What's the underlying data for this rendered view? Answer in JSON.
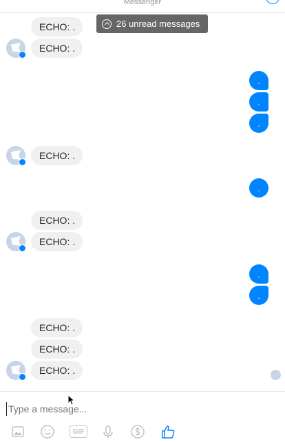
{
  "header": {
    "title": "Messenger"
  },
  "unread_banner": {
    "text": "26 unread messages"
  },
  "messages": [
    {
      "side": "in",
      "text": "ECHO: ."
    },
    {
      "side": "in",
      "text": "ECHO: ."
    },
    {
      "side": "out",
      "text": "."
    },
    {
      "side": "out",
      "text": "."
    },
    {
      "side": "out",
      "text": "."
    },
    {
      "side": "in",
      "text": "ECHO: ."
    },
    {
      "side": "out",
      "text": "."
    },
    {
      "side": "in",
      "text": "ECHO: ."
    },
    {
      "side": "in",
      "text": "ECHO: ."
    },
    {
      "side": "out",
      "text": "."
    },
    {
      "side": "out",
      "text": "."
    },
    {
      "side": "in",
      "text": "ECHO: ."
    },
    {
      "side": "in",
      "text": "ECHO: ."
    },
    {
      "side": "in",
      "text": "ECHO: ."
    }
  ],
  "composer": {
    "placeholder": "Type a message..."
  },
  "toolbar": {
    "gif_label": "GIF",
    "icons": [
      "image-icon",
      "emoji-icon",
      "gif-icon",
      "microphone-icon",
      "payment-icon",
      "thumbs-up-icon"
    ]
  },
  "colors": {
    "accent": "#0084ff",
    "incoming_bubble": "#f1f0f0",
    "unread_banner": "#4b4b4b"
  }
}
